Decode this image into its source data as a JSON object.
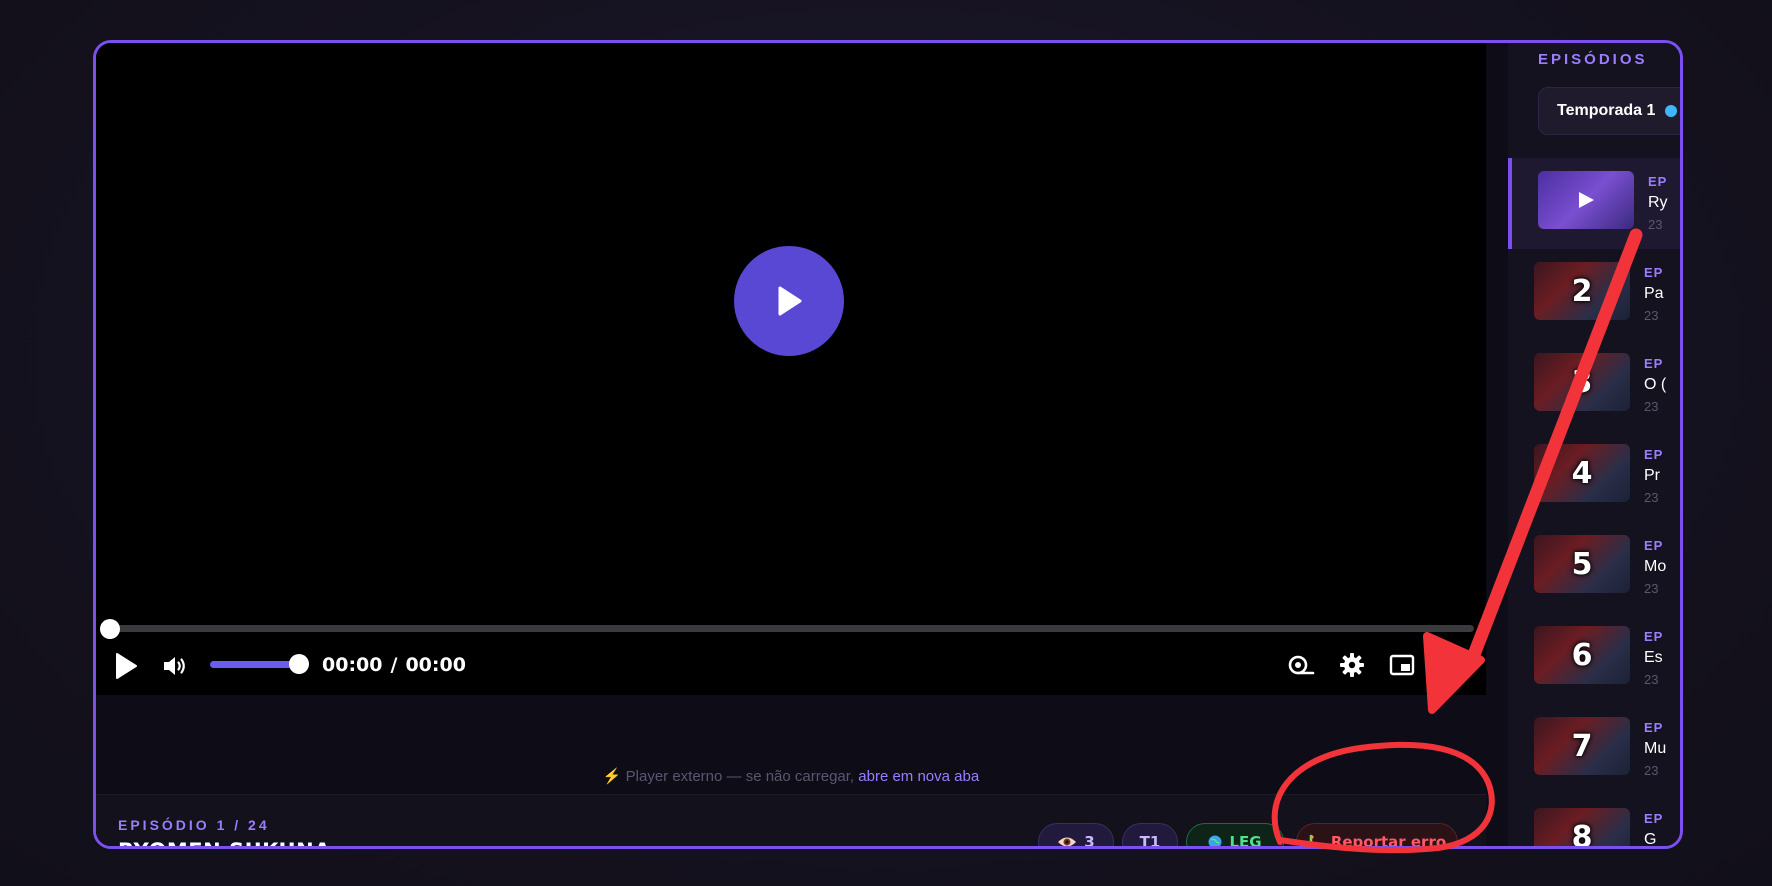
{
  "player": {
    "time_current": "00:00",
    "time_separator": "/",
    "time_total": "00:00",
    "progress": 0,
    "volume": 1,
    "external_note_prefix": "⚡ Player externo — se não carregar,",
    "external_note_link": "abre em nova aba"
  },
  "episode_info": {
    "counter": "EPISÓDIO 1 / 24",
    "title": "RYOMEN SUKUNA",
    "views": "3",
    "season_badge": "T1",
    "language_badge": "LEG",
    "report_button": "Reportar erro"
  },
  "sidebar": {
    "heading": "EPISÓDIOS",
    "season_select": "Temporada 1",
    "episodes": [
      {
        "number": "",
        "label": "EP",
        "title": "Ry",
        "duration": "23"
      },
      {
        "number": "2",
        "label": "EP",
        "title": "Pa",
        "duration": "23"
      },
      {
        "number": "3",
        "label": "EP",
        "title": "O (",
        "duration": "23"
      },
      {
        "number": "4",
        "label": "EP",
        "title": "Pr",
        "duration": "23"
      },
      {
        "number": "5",
        "label": "EP",
        "title": "Mo",
        "duration": "23"
      },
      {
        "number": "6",
        "label": "EP",
        "title": "Es",
        "duration": "23"
      },
      {
        "number": "7",
        "label": "EP",
        "title": "Mu",
        "duration": "23"
      },
      {
        "number": "8",
        "label": "EP",
        "title": "G",
        "duration": "23"
      }
    ]
  },
  "colors": {
    "accent": "#7b4ff0",
    "play_button": "#5848d4",
    "annotation": "#f2343a"
  }
}
